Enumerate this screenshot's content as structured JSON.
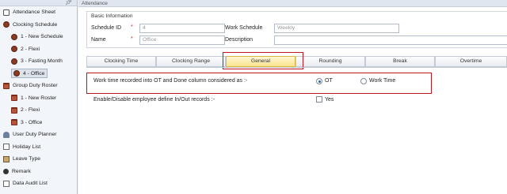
{
  "sidebar": {
    "items": [
      {
        "label": "Attendance Sheet",
        "icon": "document-icon"
      },
      {
        "label": "Clocking Schedule",
        "icon": "clock-icon"
      },
      {
        "label": "1 - New Schedule",
        "icon": "clock-icon"
      },
      {
        "label": "2 - Flexi",
        "icon": "clock-icon"
      },
      {
        "label": "3 - Fasting Month",
        "icon": "clock-icon"
      },
      {
        "label": "4 - Office",
        "icon": "clock-icon",
        "selected": true
      },
      {
        "label": "Group Duty Roster",
        "icon": "calendar-icon"
      },
      {
        "label": "1 - New Roster",
        "icon": "calendar-icon"
      },
      {
        "label": "2 - Flexi",
        "icon": "calendar-icon"
      },
      {
        "label": "3 - Office",
        "icon": "calendar-icon"
      },
      {
        "label": "User Duty Planner",
        "icon": "user-icon"
      },
      {
        "label": "Holiday List",
        "icon": "list-icon"
      },
      {
        "label": "Leave Type",
        "icon": "plane-icon"
      },
      {
        "label": "Remark",
        "icon": "person-icon"
      },
      {
        "label": "Data Audit List",
        "icon": "list-icon"
      }
    ]
  },
  "main": {
    "header": "Attendance",
    "basic_info": {
      "title": "Basic Information",
      "schedule_id_label": "Schedule ID",
      "schedule_id_value": "4",
      "name_label": "Name",
      "name_value": "Office",
      "work_schedule_label": "Work Schedule",
      "work_schedule_value": "Weekly",
      "description_label": "Description",
      "description_value": "",
      "required_mark": "*"
    },
    "tabs": [
      {
        "label": "Clocking Time"
      },
      {
        "label": "Clocking Range"
      },
      {
        "label": "General",
        "active": true
      },
      {
        "label": "Rounding"
      },
      {
        "label": "Break"
      },
      {
        "label": "Overtime"
      }
    ],
    "general": {
      "ot_question": "Work time recorded into OT and Done column considered as :-",
      "ot_option": "OT",
      "worktime_option": "Work Time",
      "selected_option": "OT",
      "enable_label": "Enable/Disable employee define In/Out records :-",
      "yes_label": "Yes",
      "yes_checked": false
    }
  },
  "colors": {
    "highlight_box": "#c0141e",
    "active_tab": "#fbe38a",
    "sidebar_bg": "#f2f5fa"
  }
}
